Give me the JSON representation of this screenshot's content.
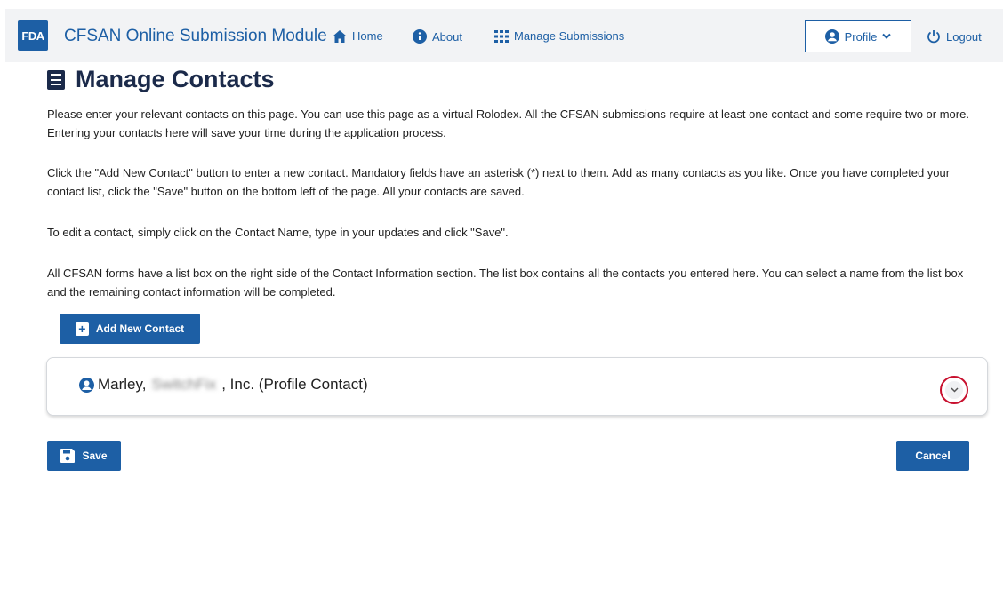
{
  "header": {
    "logo_text": "FDA",
    "app_title": "CFSAN Online Submission Module",
    "nav": {
      "home": "Home",
      "about": "About",
      "manage": "Manage Submissions"
    },
    "profile_label": "Profile",
    "logout_label": "Logout",
    "brand_color": "#1d5fa5"
  },
  "main": {
    "title": "Manage Contacts",
    "paragraphs": [
      "Please enter your relevant contacts on this page. You can use this page as a virtual Rolodex. All the CFSAN submissions require at least one contact and some require two or more. Entering your contacts here will save your time during the application process.",
      "Click the \"Add New Contact\" button to enter a new contact. Mandatory fields have an asterisk (*) next to them. Add as many contacts as you like. Once you have completed your contact list, click the \"Save\" button on the bottom left of the page. All your contacts are saved.",
      "To edit a contact, simply click on the Contact Name, type in your updates and click \"Save\".",
      "All CFSAN forms have a list box on the right side of the Contact Information section. The list box contains all the contacts you entered here. You can select a name from the list box and the remaining contact information will be completed."
    ],
    "add_button": "Add New Contact",
    "contact": {
      "last_name": "Marley,",
      "company_blurred": "SwitchFix",
      "suffix": ", Inc. (Profile Contact)"
    },
    "save_button": "Save",
    "cancel_button": "Cancel"
  }
}
